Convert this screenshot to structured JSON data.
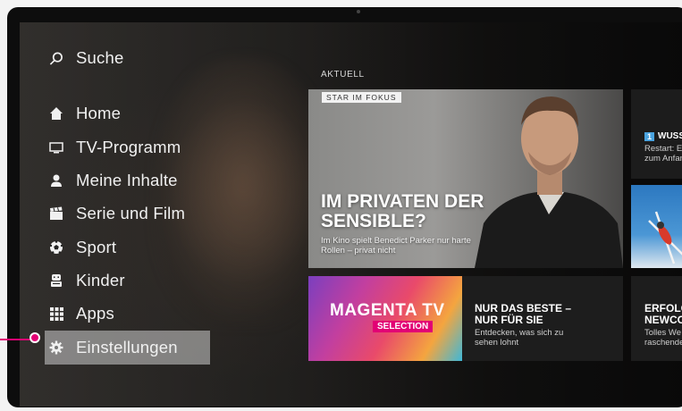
{
  "menu": {
    "search": "Suche",
    "items": [
      {
        "label": "Home",
        "icon": "home-icon"
      },
      {
        "label": "TV-Programm",
        "icon": "tv-icon"
      },
      {
        "label": "Meine Inhalte",
        "icon": "user-icon"
      },
      {
        "label": "Serie und Film",
        "icon": "clapperboard-icon"
      },
      {
        "label": "Sport",
        "icon": "soccer-ball-icon"
      },
      {
        "label": "Kinder",
        "icon": "kids-icon"
      },
      {
        "label": "Apps",
        "icon": "apps-grid-icon"
      },
      {
        "label": "Einstellungen",
        "icon": "gear-icon"
      }
    ]
  },
  "content": {
    "section_label": "AKTUELL",
    "hero": {
      "tag": "STAR IM FOKUS",
      "title": "IM PRIVATEN DER SENSIBLE?",
      "subtitle": "Im Kino spielt Benedict Parker nur harte Rollen – privat nicht"
    },
    "side_card_1": {
      "badge": "1",
      "title": "WUSS",
      "subtitle": "Restart: E zum Anfan"
    },
    "magenta": {
      "logo": "MAGENTA TV",
      "badge": "SELECTION"
    },
    "best": {
      "title": "NUR DAS BESTE – NUR FÜR SIE",
      "subtitle": "Entdecken, was sich zu sehen lohnt"
    },
    "erfolg": {
      "title1": "ERFOLG",
      "title2": "NEWCO",
      "sub1": "Tolles We",
      "sub2": "raschende"
    }
  },
  "colors": {
    "accent": "#e20074",
    "active_bg": "#cdcdcd"
  }
}
